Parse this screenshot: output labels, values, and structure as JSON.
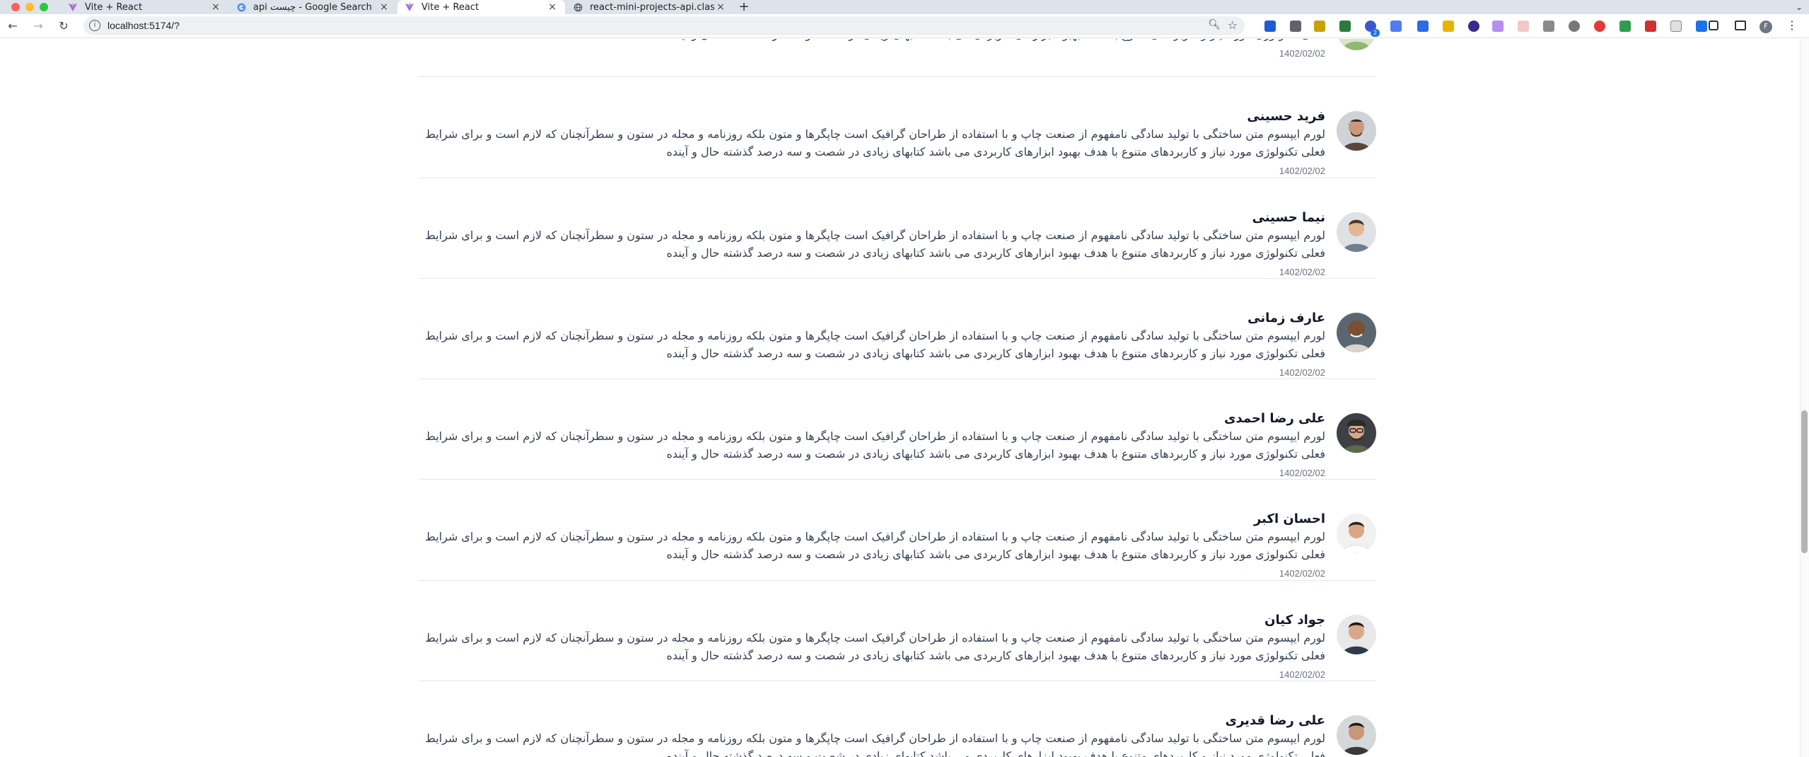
{
  "tabs": [
    {
      "title": "Vite + React",
      "favicon": "vite-icon",
      "active": false
    },
    {
      "title": "api چیست - Google Search",
      "favicon": "google-icon",
      "active": false
    },
    {
      "title": "Vite + React",
      "favicon": "vite-icon",
      "active": true
    },
    {
      "title": "react-mini-projects-api.class",
      "favicon": "globe-icon",
      "active": false
    }
  ],
  "toolbar": {
    "url": "localhost:5174/?",
    "extension_badge_count": "2",
    "profile_initial": "F"
  },
  "comment_text": "لورم ایپسوم متن ساختگی با تولید سادگی نامفهوم از صنعت چاپ و با استفاده از طراحان گرافیک است چاپگرها و متون بلکه روزنامه و مجله در ستون و سطرآنچنان که لازم است و برای شرایط فعلی تکنولوژی مورد نیاز و کاربردهای متنوع با هدف بهبود ابزارهای کاربردی می باشد کتابهای زیادی در شصت و سه درصد گذشته حال و آینده",
  "comments": [
    {
      "name": "",
      "date": "1402/02/02"
    },
    {
      "name": "فرید حسینی",
      "date": "1402/02/02"
    },
    {
      "name": "نیما حسینی",
      "date": "1402/02/02"
    },
    {
      "name": "عارف زمانی",
      "date": "1402/02/02"
    },
    {
      "name": "علی رضا احمدی",
      "date": "1402/02/02"
    },
    {
      "name": "احسان اکبر",
      "date": "1402/02/02"
    },
    {
      "name": "جواد کیان",
      "date": "1402/02/02"
    },
    {
      "name": "علی رضا قدیری",
      "date": ""
    }
  ],
  "colors": {
    "tabstrip_bg": "#dde3ea",
    "name_text": "#111827",
    "body_text": "#374151",
    "date_text": "#6b7280",
    "divider": "#e5e7eb"
  }
}
